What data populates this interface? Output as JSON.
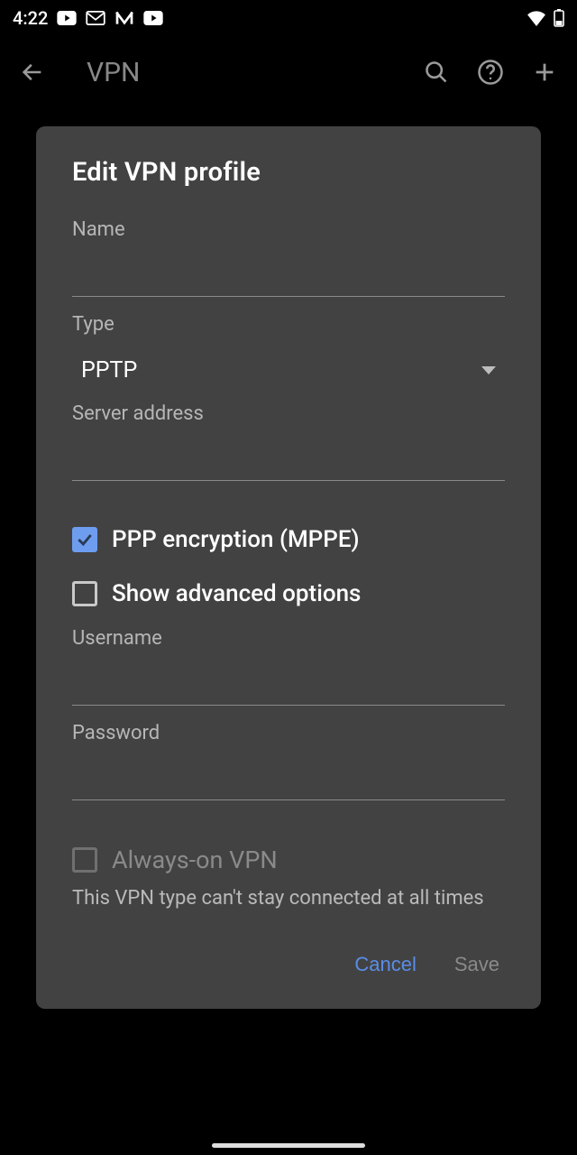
{
  "status_bar": {
    "time": "4:22"
  },
  "app_bar": {
    "title": "VPN"
  },
  "dialog": {
    "title": "Edit VPN profile",
    "name_label": "Name",
    "name_value": "",
    "type_label": "Type",
    "type_value": "PPTP",
    "server_label": "Server address",
    "server_value": "",
    "ppp_label": "PPP encryption (MPPE)",
    "ppp_checked": true,
    "advanced_label": "Show advanced options",
    "advanced_checked": false,
    "username_label": "Username",
    "username_value": "",
    "password_label": "Password",
    "password_value": "",
    "always_on_label": "Always-on VPN",
    "always_on_checked": false,
    "always_on_helper": "This VPN type can't stay connected at all times",
    "cancel_label": "Cancel",
    "save_label": "Save"
  }
}
